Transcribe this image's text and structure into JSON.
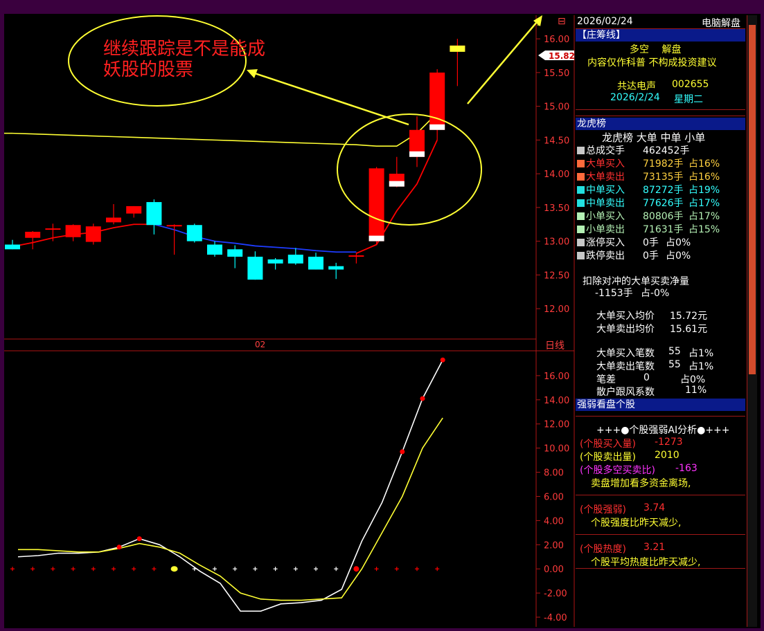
{
  "header": {
    "date": "2026/02/24",
    "title": "电脑解盘"
  },
  "annotation": {
    "text_line1": "继续跟踪是不是能成",
    "text_line2": "妖股的股票"
  },
  "main_chart": {
    "price_tag": "15.82",
    "x_label": "02",
    "zoom_glyph": "⊟",
    "arrow_glyph": "⇧"
  },
  "sub_chart": {
    "label": "日线"
  },
  "colors": {
    "up": "#ff0000",
    "down": "#00ffff",
    "ma_blue": "#1e3cff",
    "ma_yellow": "#ffff33",
    "frame": "#b01515",
    "section_header": "#0a1a8a"
  },
  "chart_data": [
    {
      "type": "candlestick",
      "ylim": [
        11.55,
        16.35
      ],
      "y_ticks": [
        "16.00",
        "15.50",
        "15.00",
        "14.50",
        "14.00",
        "13.50",
        "13.00",
        "12.50",
        "12.00"
      ],
      "candles": [
        {
          "o": 12.95,
          "h": 13.02,
          "l": 12.88,
          "c": 12.88,
          "dir": "down"
        },
        {
          "o": 13.05,
          "h": 13.15,
          "l": 12.88,
          "c": 13.14,
          "dir": "up"
        },
        {
          "o": 13.17,
          "h": 13.26,
          "l": 13.0,
          "c": 13.19,
          "dir": "up"
        },
        {
          "o": 13.06,
          "h": 13.25,
          "l": 13.0,
          "c": 13.24,
          "dir": "up"
        },
        {
          "o": 12.99,
          "h": 13.26,
          "l": 12.95,
          "c": 13.22,
          "dir": "up"
        },
        {
          "o": 13.28,
          "h": 13.55,
          "l": 13.25,
          "c": 13.35,
          "dir": "up"
        },
        {
          "o": 13.41,
          "h": 13.52,
          "l": 13.35,
          "c": 13.52,
          "dir": "up"
        },
        {
          "o": 13.58,
          "h": 13.62,
          "l": 13.1,
          "c": 13.24,
          "dir": "down"
        },
        {
          "o": 13.24,
          "h": 13.25,
          "l": 12.8,
          "c": 13.24,
          "dir": "up"
        },
        {
          "o": 13.24,
          "h": 13.26,
          "l": 12.98,
          "c": 13.0,
          "dir": "down"
        },
        {
          "o": 12.95,
          "h": 13.0,
          "l": 12.77,
          "c": 12.8,
          "dir": "down"
        },
        {
          "o": 12.88,
          "h": 12.94,
          "l": 12.6,
          "c": 12.77,
          "dir": "down"
        },
        {
          "o": 12.77,
          "h": 12.85,
          "l": 12.43,
          "c": 12.43,
          "dir": "down"
        },
        {
          "o": 12.73,
          "h": 12.75,
          "l": 12.58,
          "c": 12.67,
          "dir": "down"
        },
        {
          "o": 12.8,
          "h": 12.9,
          "l": 12.65,
          "c": 12.67,
          "dir": "down"
        },
        {
          "o": 12.77,
          "h": 12.83,
          "l": 12.58,
          "c": 12.58,
          "dir": "down"
        },
        {
          "o": 12.63,
          "h": 12.68,
          "l": 12.44,
          "c": 12.58,
          "dir": "down"
        },
        {
          "o": 12.78,
          "h": 12.83,
          "l": 12.67,
          "c": 12.79,
          "dir": "up"
        },
        {
          "o": 13.0,
          "h": 14.1,
          "l": 12.95,
          "c": 14.08,
          "dir": "up"
        },
        {
          "o": 13.81,
          "h": 14.25,
          "l": 13.8,
          "c": 14.0,
          "dir": "up"
        },
        {
          "o": 14.25,
          "h": 14.85,
          "l": 14.1,
          "c": 14.65,
          "dir": "up"
        },
        {
          "o": 14.65,
          "h": 15.55,
          "l": 14.5,
          "c": 15.5,
          "dir": "up"
        },
        {
          "o": 15.82,
          "h": 16.0,
          "l": 15.3,
          "c": 15.9,
          "dir": "up"
        }
      ],
      "ma_yellow": [
        14.6,
        14.59,
        14.58,
        14.57,
        14.56,
        14.55,
        14.54,
        14.53,
        14.52,
        14.51,
        14.5,
        14.49,
        14.48,
        14.47,
        14.46,
        14.45,
        14.44,
        14.43,
        14.41,
        14.41,
        14.6,
        14.9,
        null
      ],
      "ma_red": [
        12.92,
        12.98,
        13.05,
        13.1,
        13.13,
        13.2,
        13.25,
        13.25,
        null,
        null,
        null,
        null,
        null,
        null,
        null,
        null,
        null,
        12.82,
        12.95,
        13.45,
        13.85,
        14.5,
        null
      ],
      "ma_blue": [
        null,
        null,
        null,
        null,
        null,
        null,
        null,
        13.25,
        13.17,
        13.07,
        13.0,
        12.97,
        12.93,
        12.91,
        12.89,
        12.86,
        12.84,
        12.84,
        null,
        null,
        null,
        null,
        null
      ]
    },
    {
      "type": "line",
      "ylim": [
        -4.8,
        18.0
      ],
      "y_ticks": [
        "16.00",
        "14.00",
        "12.00",
        "10.00",
        "8.00",
        "6.00",
        "4.00",
        "2.00",
        "0.00",
        "-2.00",
        "-4.00"
      ],
      "series": [
        {
          "values": [
            1.0,
            1.1,
            1.3,
            1.3,
            1.4,
            1.8,
            2.5,
            2.0,
            1.0,
            -0.2,
            -1.2,
            -3.5,
            -3.5,
            -2.9,
            -2.8,
            -2.6,
            -1.7,
            2.3,
            5.5,
            9.7,
            14.1,
            17.3
          ]
        },
        {
          "values": [
            1.6,
            1.6,
            1.5,
            1.4,
            1.4,
            1.7,
            2.1,
            1.8,
            1.3,
            0.3,
            -0.6,
            -2.0,
            -2.5,
            -2.6,
            -2.6,
            -2.5,
            -2.4,
            0.0,
            3.0,
            6.0,
            10.0,
            12.5
          ]
        }
      ],
      "markers": [
        "red",
        "red",
        "red",
        "red",
        "red",
        "red",
        "red",
        "red",
        "yellow-dot",
        "white",
        "white",
        "white",
        "white",
        "white",
        "white",
        "white",
        "white",
        "red-dot",
        "red",
        "red",
        "red",
        "red"
      ]
    }
  ],
  "sidebar": {
    "zhuchou": {
      "header": "【庄筹线】",
      "line1": "多空　 解盘",
      "line2": "内容仅作科普 不构成投资建议",
      "name": "共达电声",
      "code": "002655",
      "date": "2026/2/24",
      "weekday": "星期二"
    },
    "longhu": {
      "header": "龙虎榜",
      "col_header": "龙虎榜 大单 中单 小单",
      "rows": [
        {
          "label": "总成交手",
          "value": "462452手",
          "pct": ""
        },
        {
          "label": "大单买入",
          "value": "71982手",
          "pct": "占16%"
        },
        {
          "label": "大单卖出",
          "value": "73135手",
          "pct": "占16%"
        },
        {
          "label": "中单买入",
          "value": "87272手",
          "pct": "占19%"
        },
        {
          "label": "中单卖出",
          "value": "77626手",
          "pct": "占17%"
        },
        {
          "label": "小单买入",
          "value": "80806手",
          "pct": "占17%"
        },
        {
          "label": "小单卖出",
          "value": "71631手",
          "pct": "占15%"
        },
        {
          "label": "涨停买入",
          "value": "0手",
          "pct": "占0%"
        },
        {
          "label": "跌停卖出",
          "value": "0手",
          "pct": "占0%"
        }
      ],
      "net_title": "扣除对冲的大单买卖净量",
      "net_value": "-1153手",
      "net_pct": "占-0%",
      "avg_buy_label": "大单买入均价",
      "avg_buy_value": "15.72元",
      "avg_sell_label": "大单卖出均价",
      "avg_sell_value": "15.61元",
      "cnt_buy_label": "大单买入笔数",
      "cnt_buy_value": "55",
      "cnt_buy_pct": "占1%",
      "cnt_sell_label": "大单卖出笔数",
      "cnt_sell_value": "55",
      "cnt_sell_pct": "占1%",
      "diff_label": "笔差",
      "diff_value": "0",
      "diff_pct": "占0%",
      "retail_label": "散户跟风系数",
      "retail_value": "11%"
    },
    "qiangruo": {
      "header": "强弱看盘个股",
      "title": "+++●个股强弱AI分析●+++",
      "buy_label": "(个股买入量)",
      "buy_value": "-1273",
      "sell_label": "(个股卖出量)",
      "sell_value": "2010",
      "ratio_label": "(个股多空买卖比)",
      "ratio_value": "-163",
      "note1": "卖盘增加看多资金离场,",
      "strength_label": "(个股强弱)",
      "strength_value": "3.74",
      "note2": "个股强度比昨天减少,",
      "heat_label": "(个股热度)",
      "heat_value": "3.21",
      "note3": "个股平均热度比昨天减少,"
    }
  }
}
